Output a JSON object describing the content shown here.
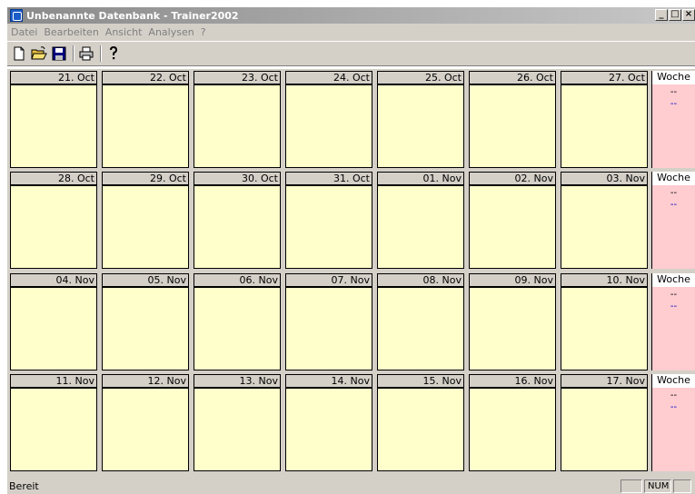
{
  "window": {
    "title": "Unbenannte Datenbank - Trainer2002",
    "minimize": "_",
    "maximize": "□",
    "close": "×"
  },
  "menu": [
    "Datei",
    "Bearbeiten",
    "Ansicht",
    "Analysen",
    "?"
  ],
  "toolbar": {
    "icons": [
      "new-file-icon",
      "open-folder-icon",
      "save-icon",
      "print-icon",
      "help-icon"
    ]
  },
  "calendar": {
    "weeks": [
      {
        "days": [
          "21. Oct",
          "22. Oct",
          "23. Oct",
          "24. Oct",
          "25. Oct",
          "26. Oct",
          "27. Oct"
        ],
        "summary_label": "Woche",
        "summary_line1": "--",
        "summary_line2": "--"
      },
      {
        "days": [
          "28. Oct",
          "29. Oct",
          "30. Oct",
          "31. Oct",
          "01. Nov",
          "02. Nov",
          "03. Nov"
        ],
        "summary_label": "Woche",
        "summary_line1": "--",
        "summary_line2": "--"
      },
      {
        "days": [
          "04. Nov",
          "05. Nov",
          "06. Nov",
          "07. Nov",
          "08. Nov",
          "09. Nov",
          "10. Nov"
        ],
        "summary_label": "Woche",
        "summary_line1": "--",
        "summary_line2": "--"
      },
      {
        "days": [
          "11. Nov",
          "12. Nov",
          "13. Nov",
          "14. Nov",
          "15. Nov",
          "16. Nov",
          "17. Nov"
        ],
        "summary_label": "Woche",
        "summary_line1": "--",
        "summary_line2": "--"
      }
    ],
    "colors": {
      "day_body": "#ffffcc",
      "week_body": "#ffccd0",
      "header": "#d4d0c8"
    }
  },
  "status": {
    "text": "Bereit",
    "num": "NUM"
  }
}
